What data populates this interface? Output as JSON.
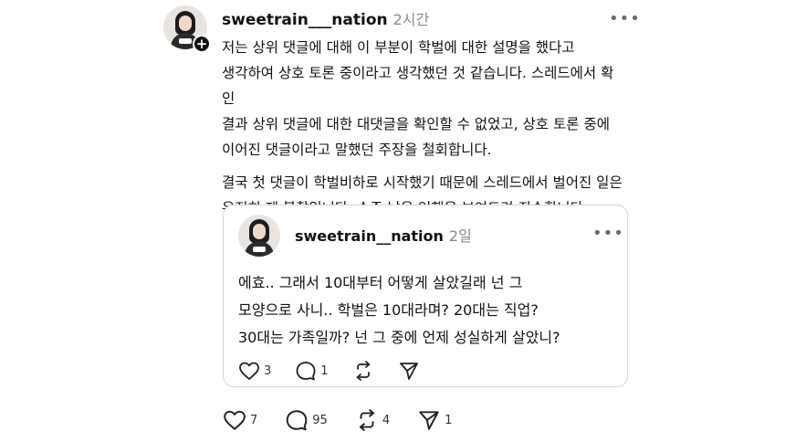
{
  "post": {
    "username": "sweetrain___nation",
    "time": "2시간",
    "more_label": "•••",
    "paragraphs": [
      "저는 상위 댓글에 대해 이 부분이 학벌에 대한 설명을 했다고\n생각하여 상호 토론 중이라고 생각했던 것 같습니다. 스레드에서 확인\n결과 상위 댓글에 대한 대댓글을 확인할 수 없었고, 상호 토론 중에\n이어진 댓글이라고 말했던 주장을 철회합니다.",
      "결국 첫 댓글이 학벌비하로 시작했기 때문에 스레드에서 벌어진 일은\n온전히 제 불찰입니다. 수준 낮은 언행을 보여드려 죄송합니다."
    ],
    "actions": {
      "likes": "7",
      "replies": "95",
      "reposts": "4",
      "shares": "1"
    }
  },
  "quoted": {
    "username": "sweetrain__nation",
    "time": "2일",
    "more_label": "•••",
    "text": "에효.. 그래서 10대부터 어떻게 살았길래 넌 그\n모양으로 사니.. 학벌은 10대라며? 20대는 직업?\n30대는 가족일까? 넌 그 중에 언제 성실하게 살았니?",
    "actions": {
      "likes": "3",
      "replies": "1"
    }
  },
  "colors": {
    "text": "#111111",
    "muted": "#8a8a8a",
    "border": "#d7d7d7"
  },
  "icons": [
    "plus-icon",
    "more-icon",
    "heart-icon",
    "comment-icon",
    "repost-icon",
    "send-icon"
  ]
}
